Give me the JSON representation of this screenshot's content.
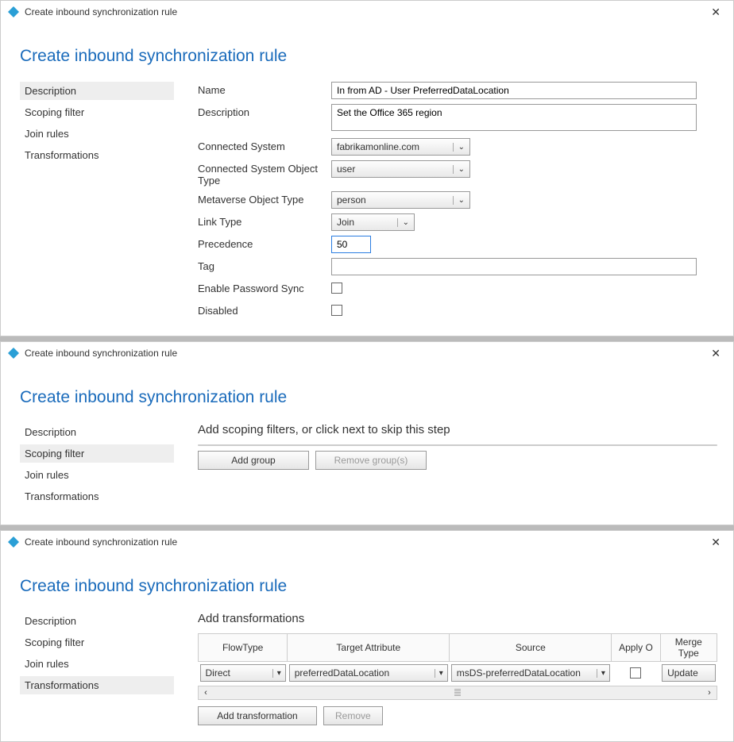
{
  "window1": {
    "title": "Create inbound synchronization rule",
    "heading": "Create inbound synchronization rule",
    "nav": {
      "description": "Description",
      "scoping": "Scoping filter",
      "join": "Join rules",
      "transformations": "Transformations"
    },
    "labels": {
      "name": "Name",
      "description": "Description",
      "connected_system": "Connected System",
      "cs_object_type": "Connected System Object Type",
      "mv_object_type": "Metaverse Object Type",
      "link_type": "Link Type",
      "precedence": "Precedence",
      "tag": "Tag",
      "enable_pw_sync": "Enable Password Sync",
      "disabled": "Disabled"
    },
    "values": {
      "name": "In from AD - User PreferredDataLocation",
      "description": "Set the Office 365 region",
      "connected_system": "fabrikamonline.com",
      "cs_object_type": "user",
      "mv_object_type": "person",
      "link_type": "Join",
      "precedence": "50",
      "tag": ""
    }
  },
  "window2": {
    "title": "Create inbound synchronization rule",
    "heading": "Create inbound synchronization rule",
    "nav": {
      "description": "Description",
      "scoping": "Scoping filter",
      "join": "Join rules",
      "transformations": "Transformations"
    },
    "section_heading": "Add scoping filters, or click next to skip this step",
    "buttons": {
      "add_group": "Add group",
      "remove_groups": "Remove group(s)"
    }
  },
  "window3": {
    "title": "Create inbound synchronization rule",
    "heading": "Create inbound synchronization rule",
    "nav": {
      "description": "Description",
      "scoping": "Scoping filter",
      "join": "Join rules",
      "transformations": "Transformations"
    },
    "section_heading": "Add transformations",
    "table": {
      "headers": {
        "flowtype": "FlowType",
        "target": "Target Attribute",
        "source": "Source",
        "apply": "Apply O",
        "merge": "Merge Type"
      },
      "row": {
        "flowtype": "Direct",
        "target": "preferredDataLocation",
        "source": "msDS-preferredDataLocation",
        "merge": "Update"
      }
    },
    "buttons": {
      "add_transformation": "Add transformation",
      "remove": "Remove"
    }
  }
}
